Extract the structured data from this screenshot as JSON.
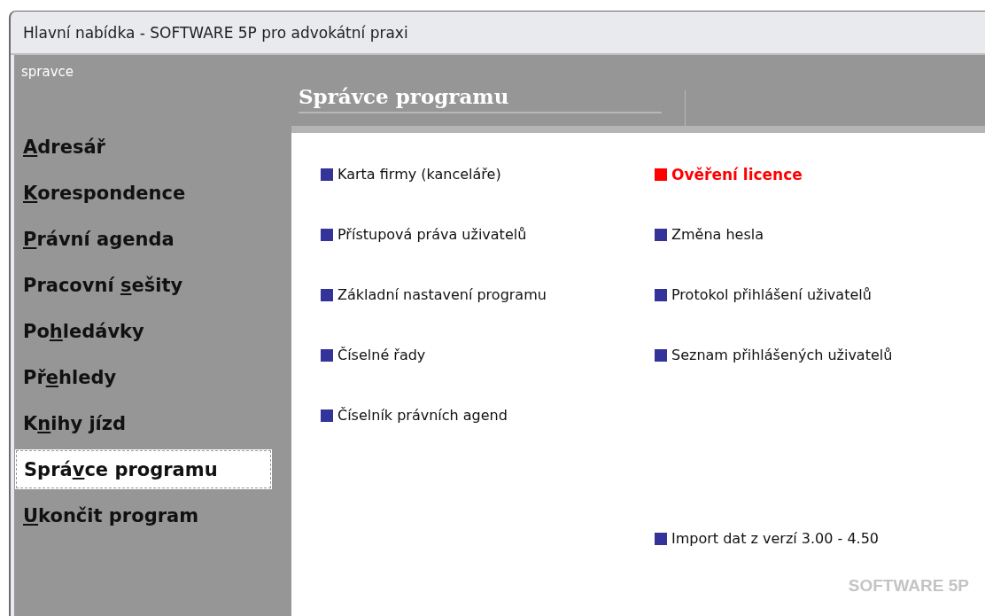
{
  "window": {
    "title": "Hlavní nabídka - SOFTWARE 5P pro advokátní praxi"
  },
  "user": "spravce",
  "sidebar": {
    "items": [
      {
        "key": "A",
        "after": "dresář",
        "selected": false
      },
      {
        "key": "K",
        "after": "orespondence",
        "selected": false
      },
      {
        "key": "P",
        "after": "rávní agenda",
        "selected": false
      },
      {
        "before": "Pracovní ",
        "key": "s",
        "after": "ešity",
        "selected": false
      },
      {
        "before": "Po",
        "key": "h",
        "after": "ledávky",
        "selected": false
      },
      {
        "before": "Př",
        "key": "e",
        "after": "hledy",
        "selected": false
      },
      {
        "before": "K",
        "key": "n",
        "after": "ihy jízd",
        "selected": false
      },
      {
        "before": "Sprá",
        "key": "v",
        "after": "ce programu",
        "selected": true
      },
      {
        "key": "U",
        "after": "končit program",
        "selected": false
      }
    ]
  },
  "section_title": "Správce programu",
  "left_links": [
    {
      "label": "Karta firmy (kanceláře)",
      "color": "#333399",
      "alert": false
    },
    {
      "label": "Přístupová práva uživatelů",
      "color": "#333399",
      "alert": false
    },
    {
      "label": "Základní nastavení programu",
      "color": "#333399",
      "alert": false
    },
    {
      "label": "Číselné řady",
      "color": "#333399",
      "alert": false
    },
    {
      "label": "Číselník právních agend",
      "color": "#333399",
      "alert": false
    }
  ],
  "right_links": [
    {
      "label": "Ověření licence",
      "color": "#ff0000",
      "alert": true
    },
    {
      "label": "Změna hesla",
      "color": "#333399",
      "alert": false
    },
    {
      "label": "Protokol přihlášení uživatelů",
      "color": "#333399",
      "alert": false
    },
    {
      "label": "Seznam přihlášených uživatelů",
      "color": "#333399",
      "alert": false
    }
  ],
  "bottom_link": {
    "label": "Import dat z verzí 3.00 - 4.50",
    "color": "#333399",
    "alert": false
  },
  "footer_brand": "SOFTWARE 5P"
}
